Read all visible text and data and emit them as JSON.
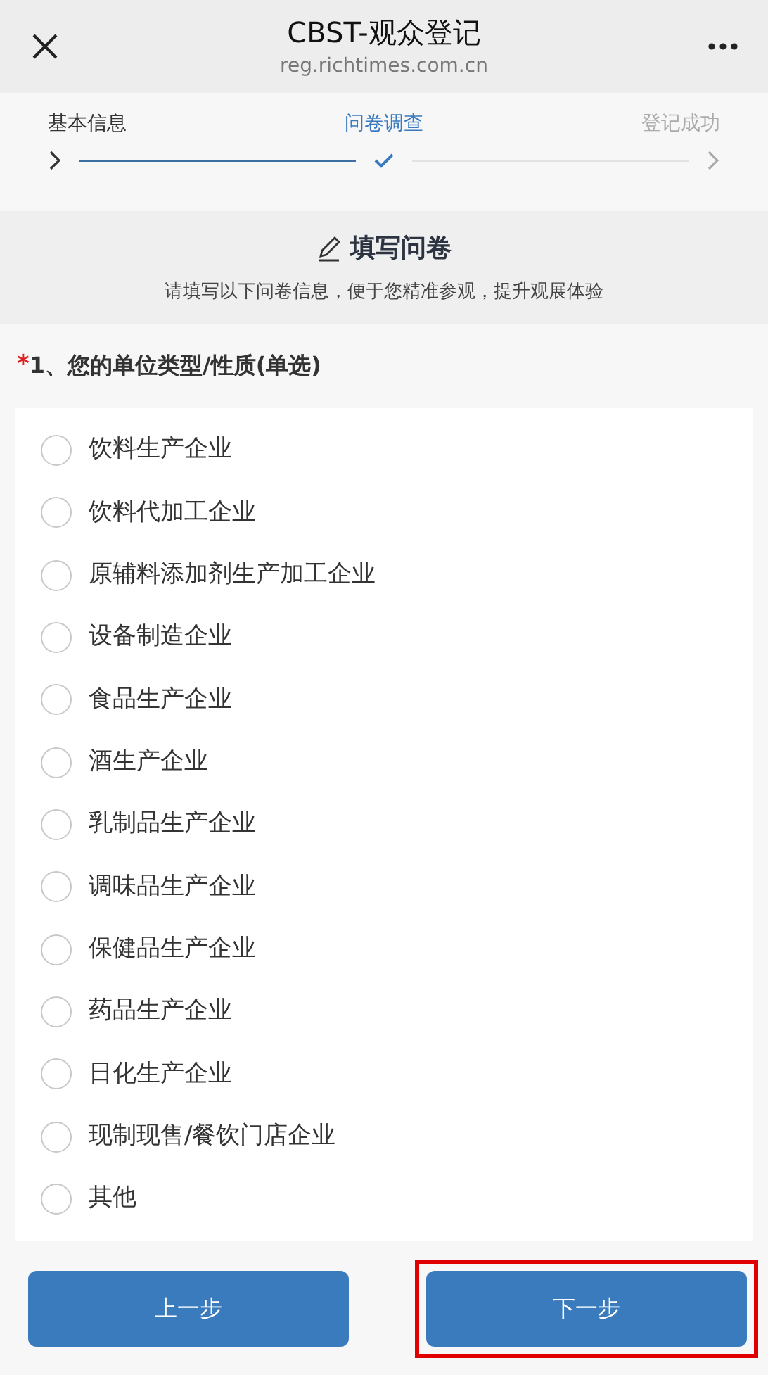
{
  "header": {
    "title": "CBST-观众登记",
    "url": "reg.richtimes.com.cn"
  },
  "steps": [
    {
      "label": "基本信息",
      "done": true,
      "selected": false
    },
    {
      "label": "问卷调查",
      "done": false,
      "selected": true
    },
    {
      "label": "登记成功",
      "done": false,
      "selected": false
    }
  ],
  "section": {
    "title": "填写问卷",
    "subtitle": "请填写以下问卷信息，便于您精准参观，提升观展体验"
  },
  "question": {
    "required_mark": "*",
    "text": "1、您的单位类型/性质(单选)"
  },
  "options": [
    {
      "label": "饮料生产企业",
      "selected": false
    },
    {
      "label": "饮料代加工企业",
      "selected": false
    },
    {
      "label": "原辅料添加剂生产加工企业",
      "selected": false
    },
    {
      "label": "设备制造企业",
      "selected": false
    },
    {
      "label": "食品生产企业",
      "selected": false
    },
    {
      "label": "酒生产企业",
      "selected": false
    },
    {
      "label": "乳制品生产企业",
      "selected": false
    },
    {
      "label": "调味品生产企业",
      "selected": false
    },
    {
      "label": "保健品生产企业",
      "selected": false
    },
    {
      "label": "药品生产企业",
      "selected": false
    },
    {
      "label": "日化生产企业",
      "selected": false
    },
    {
      "label": "现制现售/餐饮门店企业",
      "selected": false
    },
    {
      "label": "其他",
      "selected": false
    }
  ],
  "buttons": [
    {
      "label": "上一步",
      "highlighted": false
    },
    {
      "label": "下一步",
      "highlighted": true
    }
  ]
}
